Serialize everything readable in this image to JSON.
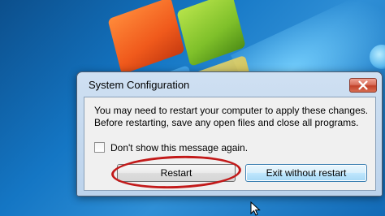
{
  "dialog": {
    "title": "System Configuration",
    "message_line1": "You may need to restart your computer to apply these changes.",
    "message_line2": "Before restarting, save any open files and close all programs.",
    "checkbox_label": "Don't show this message again.",
    "checkbox_checked": false,
    "buttons": {
      "restart": "Restart",
      "exit": "Exit without restart"
    }
  },
  "icons": {
    "close": "close-icon",
    "cursor": "mouse-pointer-icon"
  },
  "colors": {
    "highlight_ring": "#c21a1a",
    "focused_button_border": "#3c7fb1"
  }
}
